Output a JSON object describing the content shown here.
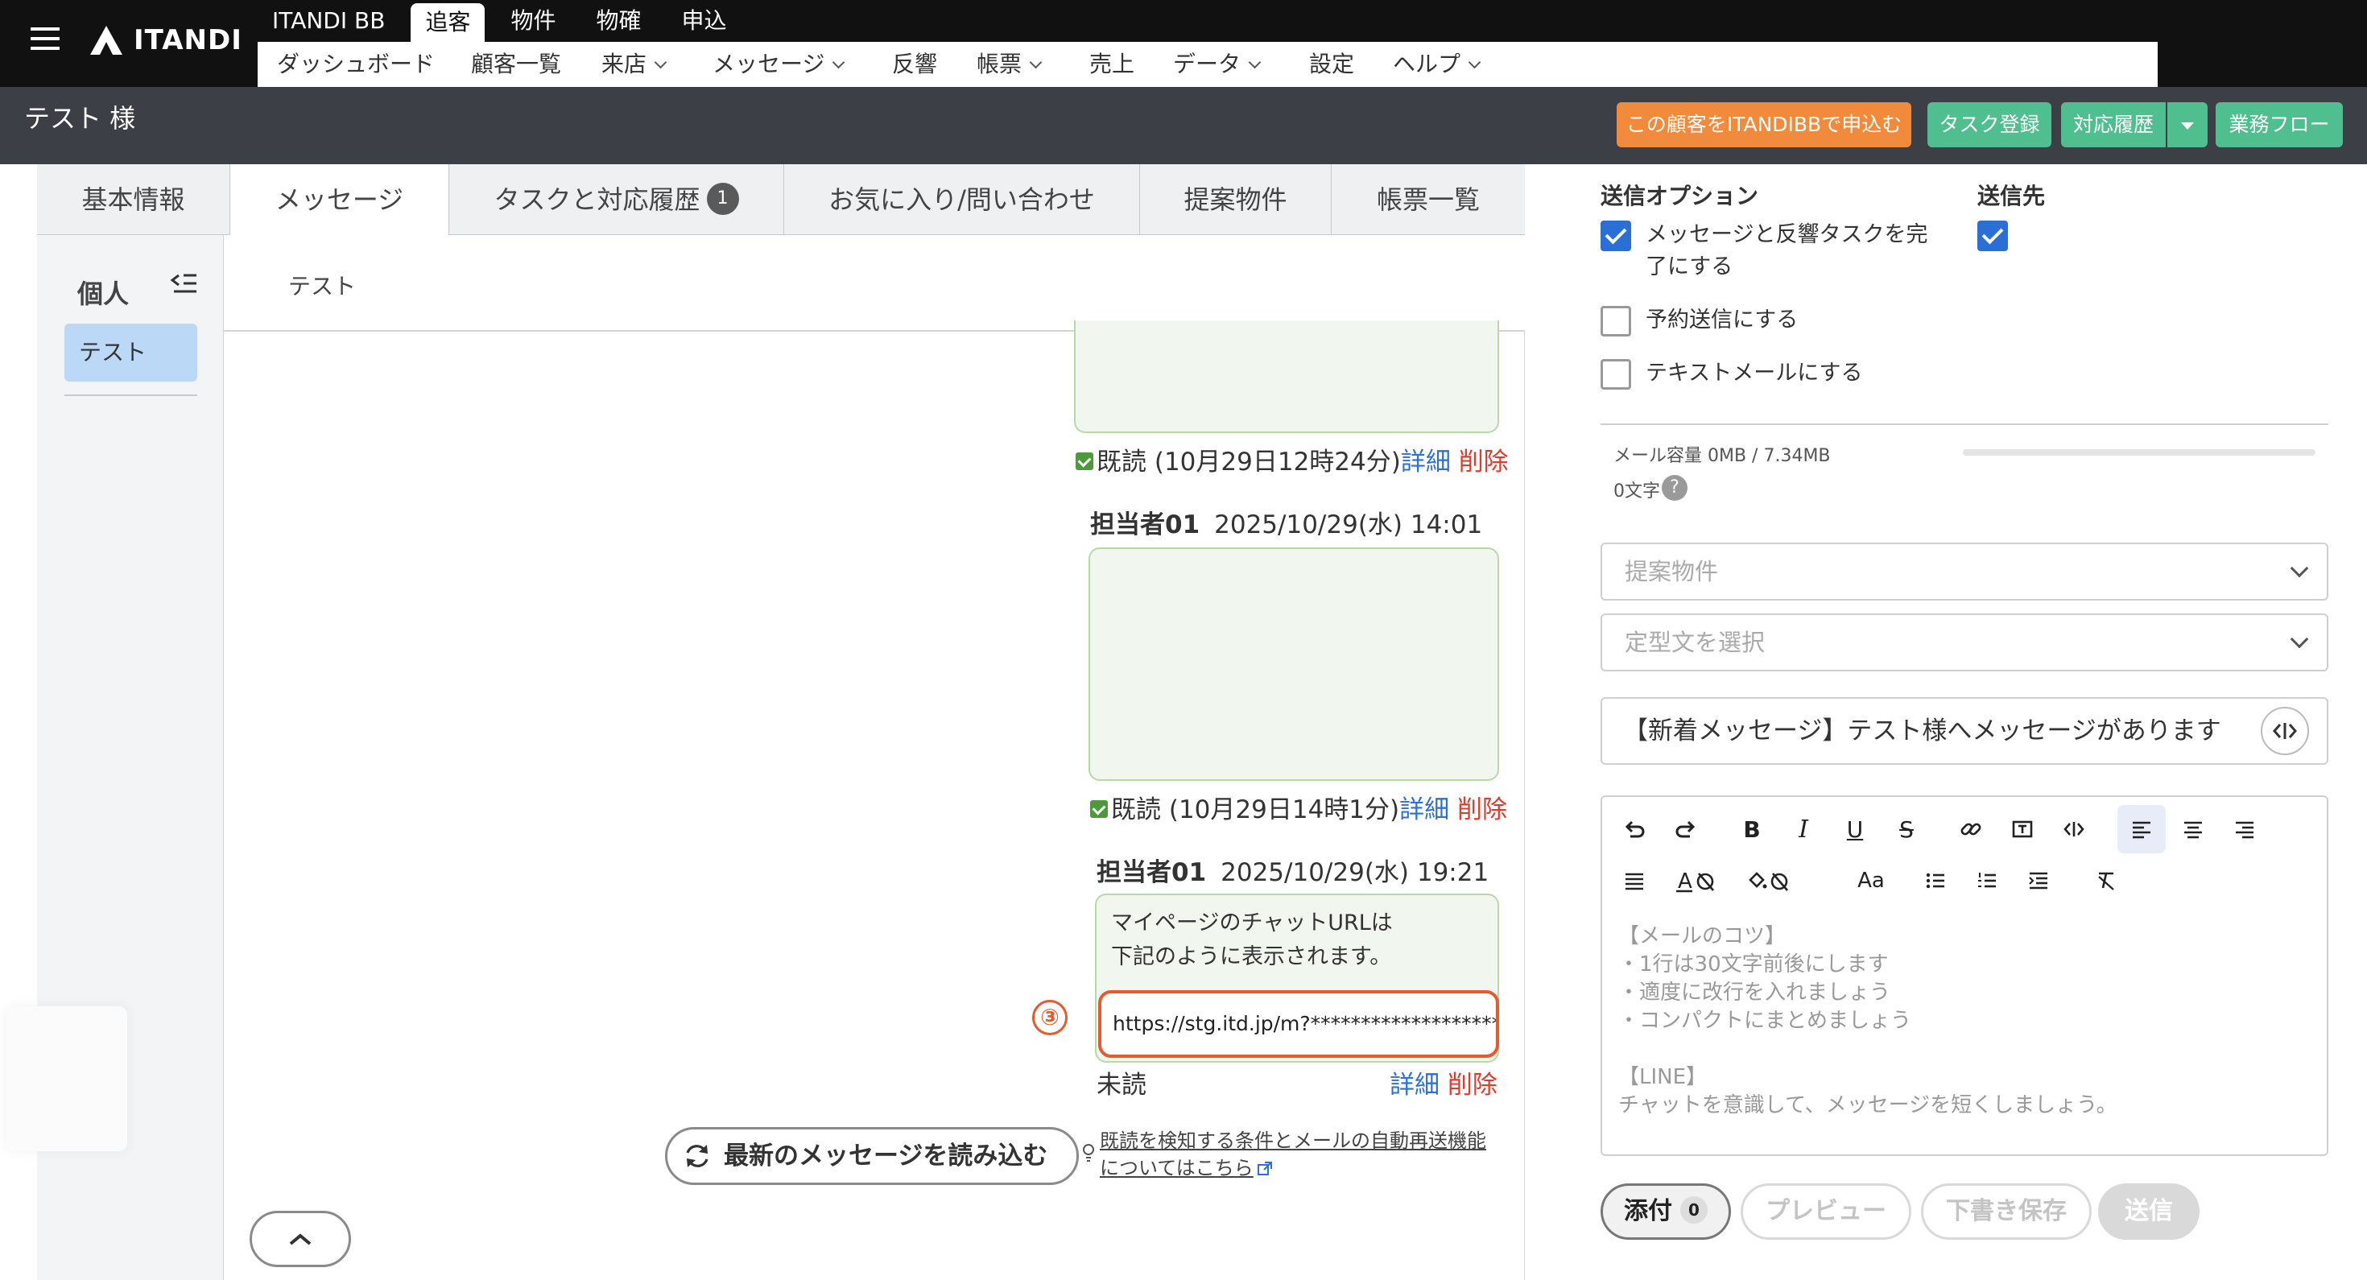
{
  "header": {
    "logo_text": "ITANDI",
    "top_nav": [
      "ITANDI BB",
      "追客",
      "物件",
      "物確",
      "申込"
    ],
    "active_top_nav": "追客",
    "sub_nav": [
      {
        "label": "ダッシュボード",
        "dropdown": false
      },
      {
        "label": "顧客一覧",
        "dropdown": false
      },
      {
        "label": "来店",
        "dropdown": true
      },
      {
        "label": "メッセージ",
        "dropdown": true
      },
      {
        "label": "反響",
        "dropdown": false
      },
      {
        "label": "帳票",
        "dropdown": true
      },
      {
        "label": "売上",
        "dropdown": false
      },
      {
        "label": "データ",
        "dropdown": true
      },
      {
        "label": "設定",
        "dropdown": false
      },
      {
        "label": "ヘルプ",
        "dropdown": true
      }
    ],
    "customer_name": "テスト 様",
    "actions": {
      "apply_itandibb": "この顧客をITANDIBBで申込む",
      "task_register": "タスク登録",
      "history": "対応履歴",
      "workflow": "業務フロー"
    },
    "colors": {
      "apply": "#f28a3c",
      "green": "#4fbf8f",
      "header_bg": "#111111",
      "titlebar_bg": "#3c3f46"
    }
  },
  "tabs": {
    "basic": "基本情報",
    "message": "メッセージ",
    "tasks": "タスクと対応履歴",
    "tasks_badge": "1",
    "favorites": "お気に入り/問い合わせ",
    "proposals": "提案物件",
    "reports": "帳票一覧"
  },
  "sidebar": {
    "title": "個人",
    "items": [
      "テスト"
    ]
  },
  "chat": {
    "header_name": "テスト",
    "messages": [
      {
        "status": "既読 (10月29日12時24分)",
        "detail": "詳細",
        "delete": "削除"
      },
      {
        "sender": "担当者01",
        "time": "2025/10/29(水) 14:01",
        "status": "既読 (10月29日14時1分)",
        "detail": "詳細",
        "delete": "削除"
      },
      {
        "sender": "担当者01",
        "time": "2025/10/29(水) 19:21",
        "line1": "マイページのチャットURLは",
        "line2": "下記のように表示されます。",
        "url": "https://stg.itd.jp/m?**********************",
        "status": "未読",
        "detail": "詳細",
        "delete": "削除"
      }
    ],
    "step_marker": "③",
    "reload_button": "最新のメッセージを読み込む",
    "notice_line1": "既読を検知する条件とメールの自動再送機能",
    "notice_line2": "についてはこちら"
  },
  "send_panel": {
    "options_title": "送信オプション",
    "dest_title": "送信先",
    "options": [
      {
        "label_line1": "メッセージと反響タスクを完",
        "label_line2": "了にする",
        "checked": true
      },
      {
        "label_line1": "予約送信にする",
        "checked": false
      },
      {
        "label_line1": "テキストメールにする",
        "checked": false
      }
    ],
    "dest_checked": true,
    "capacity": "メール容量 0MB / 7.34MB",
    "char_count": "0文字",
    "help_icon": "?",
    "proposal_placeholder": "提案物件",
    "template_placeholder": "定型文を選択",
    "subject": "【新着メッセージ】テスト様へメッセージがあります",
    "editor_placeholder": "【メールのコツ】\n・1行は30文字前後にします\n・適度に改行を入れましょう\n・コンパクトにまとめましょう\n\n【LINE】\nチャットを意識して、メッセージを短くしましょう。",
    "buttons": {
      "attach": "添付",
      "attach_count": "0",
      "preview": "プレビュー",
      "draft": "下書き保存",
      "send": "送信"
    }
  }
}
